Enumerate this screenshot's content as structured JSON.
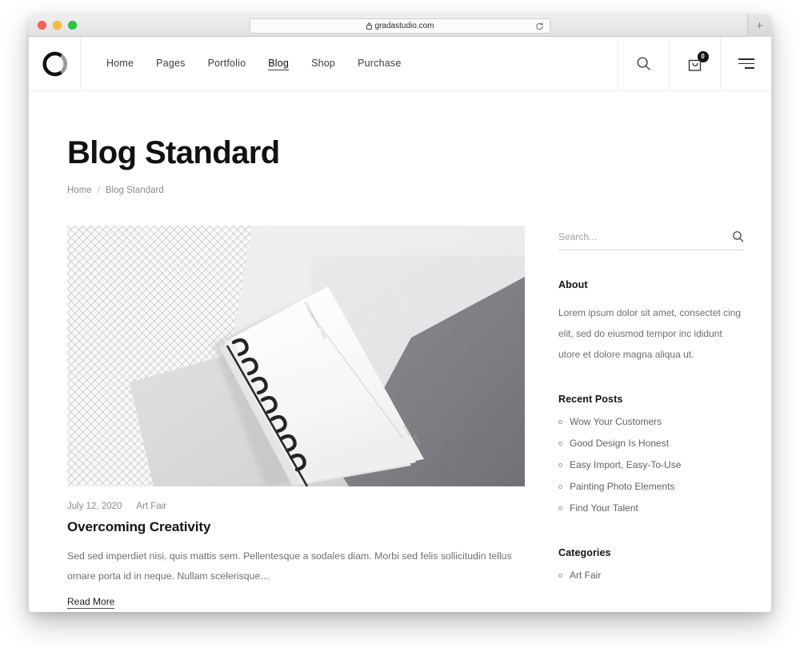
{
  "browser": {
    "url": "gradastudio.com",
    "lock_icon": "lock-icon",
    "reload_icon": "reload-icon",
    "newtab_label": "+",
    "traffic_lights": [
      "close",
      "minimize",
      "maximize"
    ]
  },
  "header": {
    "logo_name": "gradastudio-logo",
    "nav": [
      {
        "label": "Home",
        "active": false
      },
      {
        "label": "Pages",
        "active": false
      },
      {
        "label": "Portfolio",
        "active": false
      },
      {
        "label": "Blog",
        "active": true
      },
      {
        "label": "Shop",
        "active": false
      },
      {
        "label": "Purchase",
        "active": false
      }
    ],
    "search_icon": "search-icon",
    "cart_icon": "shopping-bag-icon",
    "cart_count": "0",
    "menu_icon": "hamburger-menu-icon"
  },
  "page": {
    "title": "Blog Standard",
    "breadcrumb": {
      "home": "Home",
      "separator": "/",
      "current": "Blog Standard"
    }
  },
  "post": {
    "image_name": "notebook-flatlay-photo",
    "date": "July 12, 2020",
    "category": "Art Fair",
    "title": "Overcoming Creativity",
    "excerpt": "Sed sed imperdiet nisi, quis mattis sem. Pellentesque a sodales diam. Morbi sed felis sollicitudin tellus ornare porta id in neque. Nullam scelerisque…",
    "read_more": "Read More"
  },
  "sidebar": {
    "search": {
      "placeholder": "Search...",
      "icon": "search-icon"
    },
    "about": {
      "title": "About",
      "text": "Lorem ipsum dolor sit amet, consectet cing elit, sed do eiusmod tempor inc ididunt utore et dolore magna aliqua ut."
    },
    "recent_posts": {
      "title": "Recent Posts",
      "items": [
        "Wow Your Customers",
        "Good Design Is Honest",
        "Easy Import, Easy-To-Use",
        "Painting Photo Elements",
        "Find Your Talent"
      ]
    },
    "categories": {
      "title": "Categories",
      "items": [
        "Art Fair"
      ]
    }
  },
  "colors": {
    "text_dark": "#111111",
    "text_body": "#6f6f6f",
    "text_muted": "#8c8c8c",
    "border": "#ededed",
    "badge": "#111111"
  }
}
